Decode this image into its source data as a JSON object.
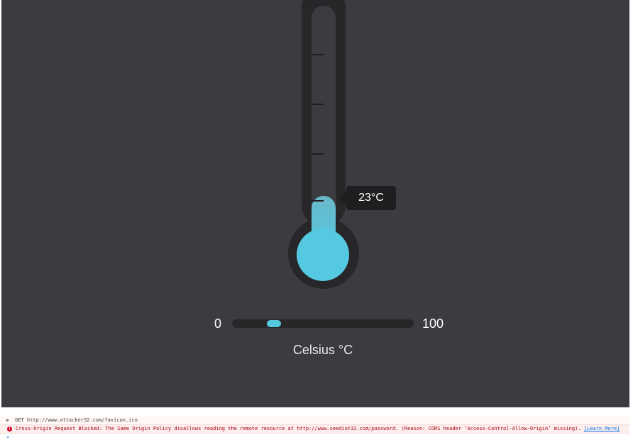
{
  "thermometer": {
    "value": 23,
    "min": 0,
    "max": 100,
    "display": "23°C",
    "unit_label": "Celsius °C",
    "mercury_color": "#56c8e0"
  },
  "slider": {
    "min_label": "0",
    "max_label": "100",
    "value": 23
  },
  "console": {
    "entries": [
      {
        "type": "request",
        "method": "GET",
        "url": "http://www.attacker32.com/favicon.ico"
      },
      {
        "type": "error",
        "text_before": "Cross-Origin Request Blocked: The Same Origin Policy disallows reading the remote resource at",
        "url": "http://www.seediot32.com/password.",
        "text_after": "(Reason: CORS header ‘Access-Control-Allow-Origin’ missing).",
        "link": "[Learn More]"
      }
    ],
    "prompt": "»"
  },
  "colors": {
    "background": "#3c3c40",
    "dark": "#27272a",
    "accent": "#56c8e0",
    "error": "#a4000f"
  }
}
